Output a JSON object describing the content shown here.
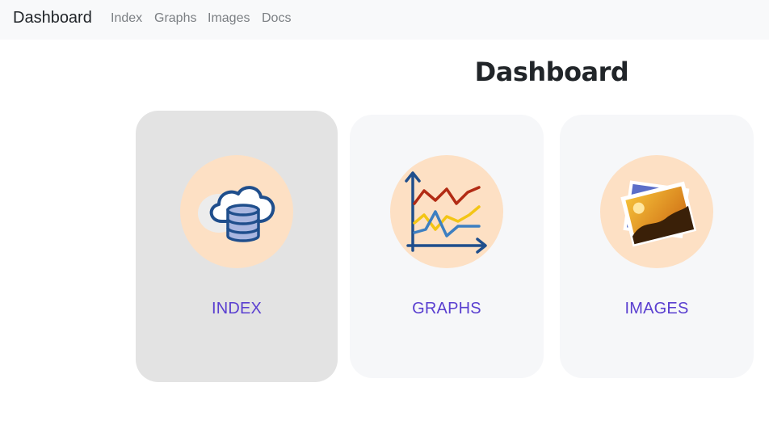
{
  "navbar": {
    "brand": "Dashboard",
    "links": [
      "Index",
      "Graphs",
      "Images",
      "Docs"
    ]
  },
  "main": {
    "title": "Dashboard",
    "cards": [
      {
        "label": "INDEX",
        "icon": "cloud-database-icon",
        "active": true
      },
      {
        "label": "GRAPHS",
        "icon": "line-chart-icon",
        "active": false
      },
      {
        "label": "IMAGES",
        "icon": "photos-icon",
        "active": false
      }
    ]
  },
  "colors": {
    "navbar_bg": "#f8f9fa",
    "card_bg": "#f6f7f9",
    "card_active_bg": "#e3e3e3",
    "icon_circle": "#fde0c4",
    "label": "#5a3fd0"
  }
}
